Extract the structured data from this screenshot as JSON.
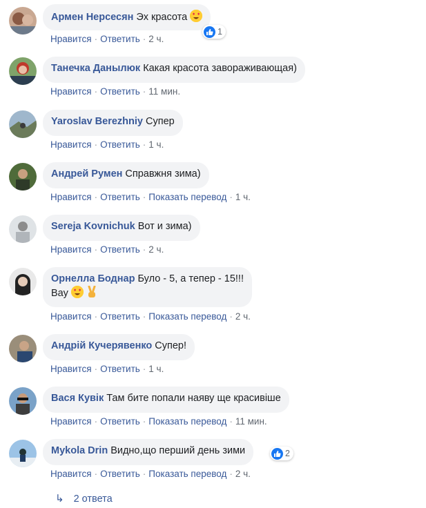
{
  "labels": {
    "like": "Нравится",
    "reply": "Ответить",
    "translate": "Показать перевод",
    "separator": "·"
  },
  "comments": [
    {
      "author": "Армен Нерсесян",
      "text": "Эх красота",
      "time": "2 ч.",
      "translate": false,
      "reactions": "1",
      "emoji": "heart-eyes"
    },
    {
      "author": "Танечка Данылюк",
      "text": "Какая красота завораживающая)",
      "time": "11 мин.",
      "translate": false
    },
    {
      "author": "Yaroslav Berezhniy",
      "text": "Супер",
      "time": "1 ч.",
      "translate": false
    },
    {
      "author": "Андрей Румен",
      "text": "Справжня зима)",
      "time": "1 ч.",
      "translate": true
    },
    {
      "author": "Sereja Kovnichuk",
      "text": "Вот и зима)",
      "time": "2 ч.",
      "translate": false
    },
    {
      "author": "Орнелла Боднар",
      "text": "Було - 5, а тепер - 15!!!",
      "text2": "Вау",
      "time": "2 ч.",
      "translate": true,
      "emoji": "heart-eyes victory-hand"
    },
    {
      "author": "Андрій Кучерявенко",
      "text": "Супер!",
      "time": "1 ч.",
      "translate": false
    },
    {
      "author": "Вася Кувік",
      "text": "Там бите попали наяву ще красивіше",
      "time": "11 мин.",
      "translate": true
    },
    {
      "author": "Mykola Drin",
      "text": "Видно,що перший день зими",
      "time": "2 ч.",
      "translate": true,
      "reactions": "2"
    }
  ],
  "replies": {
    "label": "2 ответа",
    "icon": "reply-arrow-icon"
  },
  "colors": {
    "link": "#385898",
    "bubble": "#f2f3f5",
    "like": "#1877f2"
  }
}
